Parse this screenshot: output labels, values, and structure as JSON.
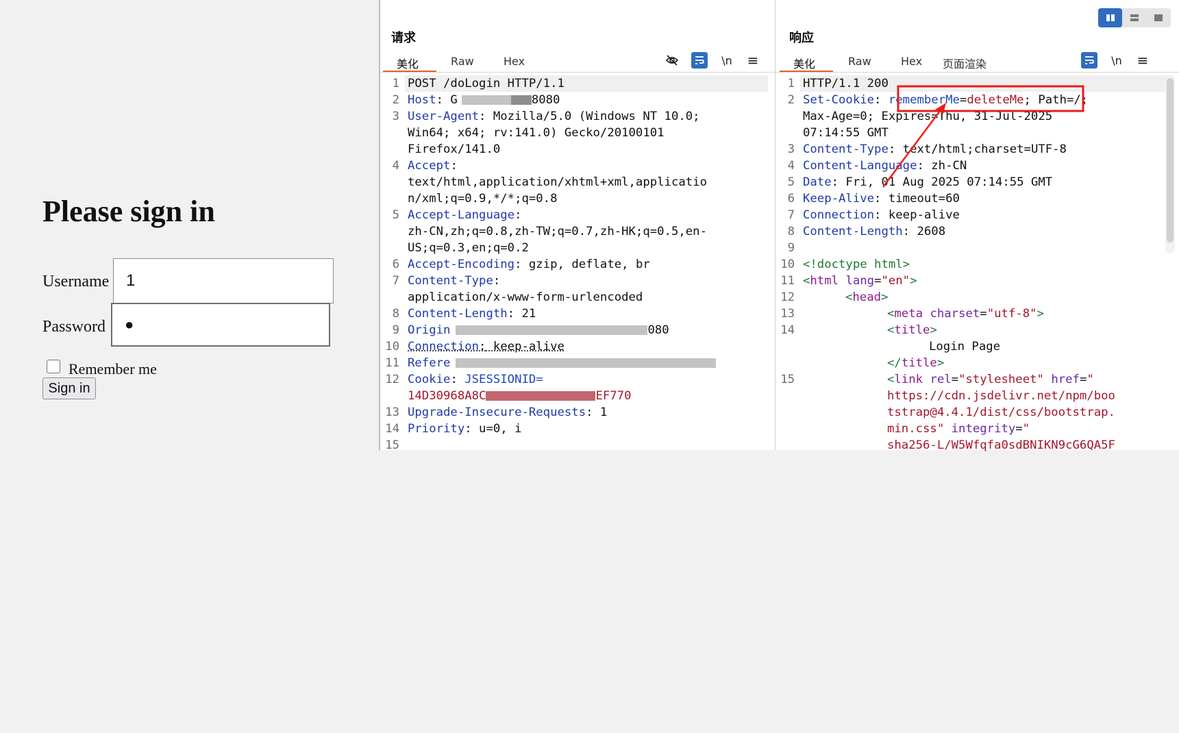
{
  "login": {
    "title": "Please sign in",
    "username_label": "Username",
    "username_value": "1",
    "password_label": "Password",
    "password_value": "●",
    "remember_label": "Remember me",
    "signin_label": "Sign in"
  },
  "request": {
    "title": "请求",
    "tabs": [
      "美化",
      "Raw",
      "Hex"
    ],
    "icons": [
      "eye-slash-icon",
      "wrap-icon",
      "newline-icon",
      "menu-icon"
    ],
    "newline_glyph": "\\n",
    "menu_glyph": "≡",
    "lines": {
      "l1": "POST /doLogin HTTP/1.1",
      "host_k": "Host",
      "host_v1": " G",
      "host_v2": "8080",
      "ua_k": "User-Agent",
      "ua_v": " Mozilla/5.0 (Windows NT 10.0;",
      "ua_c1": "Win64; x64; rv:141.0) Gecko/20100101",
      "ua_c2": "Firefox/141.0",
      "acc_k": "Accept",
      "acc_c1": "text/html,application/xhtml+xml,applicatio",
      "acc_c2": "n/xml;q=0.9,*/*;q=0.8",
      "al_k": "Accept-Language",
      "al_c1": "zh-CN,zh;q=0.8,zh-TW;q=0.7,zh-HK;q=0.5,en-",
      "al_c2": "US;q=0.3,en;q=0.2",
      "ae_k": "Accept-Encoding",
      "ae_v": " gzip, deflate, br",
      "ct_k": "Content-Type",
      "ct_c1": "application/x-www-form-urlencoded",
      "cl_k": "Content-Length",
      "cl_v": " 21",
      "or_k": "Origin",
      "or_v": "080",
      "cn_k": "Connection",
      "cn_v": " keep-alive",
      "rf_k": "Refere",
      "ck_k": "Cookie",
      "ck_v": " JSESSIONID=",
      "ck_c1": "14D30968A8C",
      "ck_c2": "EF770",
      "ui_k": "Upgrade-Insecure-Requests",
      "ui_v": " 1",
      "pr_k": "Priority",
      "pr_v": " u=0, i"
    },
    "line_numbers": [
      "1",
      "2",
      "3",
      "4",
      "5",
      "6",
      "7",
      "8",
      "9",
      "10",
      "11",
      "12",
      "13",
      "14",
      "15"
    ]
  },
  "response": {
    "title": "响应",
    "tabs": [
      "美化",
      "Raw",
      "Hex",
      "页面渲染"
    ],
    "icons": [
      "wrap-icon",
      "newline-icon",
      "menu-icon"
    ],
    "newline_glyph": "\\n",
    "menu_glyph": "≡",
    "lines": {
      "l1": "HTTP/1.1 200",
      "sc_k": "Set-Cookie",
      "sc_name": "rememberMe",
      "sc_eq": "=",
      "sc_val": "deleteMe",
      "sc_rest": "; Path=/;",
      "sc_c1": "Max-Age=0; Expires=Thu, 31-Jul-2025",
      "sc_c2": "07:14:55 GMT",
      "ct_k": "Content-Type",
      "ct_v": " text/html;charset=UTF-8",
      "cl_k": "Content-Language",
      "cl_v": " zh-CN",
      "dt_k": "Date",
      "dt_v": " Fri, 01 Aug 2025 07:14:55 GMT",
      "ka_k": "Keep-Alive",
      "ka_v": " timeout=60",
      "cn_k": "Connection",
      "cn_v": " keep-alive",
      "len_k": "Content-Length",
      "len_v": " 2608",
      "doctype": "<!doctype html>",
      "html_tag": "html",
      "html_attr": "lang",
      "html_val": "\"en\"",
      "head_tag": "head",
      "meta_tag": "meta",
      "meta_attr": "charset",
      "meta_val": "\"utf-8\"",
      "title_tag": "title",
      "title_text": "Login Page",
      "link_tag": "link",
      "link_rel": "rel",
      "link_rel_val": "\"stylesheet\"",
      "link_href": "href",
      "link_href_q": "\"",
      "href_c1": "https://cdn.jsdelivr.net/npm/boo",
      "href_c2": "tstrap@4.4.1/dist/css/bootstrap.",
      "href_c3": "min.css\"",
      "integrity": "integrity",
      "integrity_q": "\"",
      "int_c1": "sha256-L/W5Wfqfa0sdBNIKN9cG6QA5F"
    },
    "line_numbers": [
      "1",
      "2",
      "",
      "",
      "3",
      "4",
      "5",
      "6",
      "7",
      "8",
      "9",
      "10",
      "11",
      "12",
      "13",
      "14",
      "",
      "",
      "15",
      "",
      "",
      ""
    ]
  },
  "layout_switch": [
    "split-columns-icon",
    "split-rows-icon",
    "single-pane-icon"
  ],
  "colors": {
    "accent": "#e8632a",
    "blue": "#2f6cc0",
    "annotation": "#ee1c1c"
  }
}
